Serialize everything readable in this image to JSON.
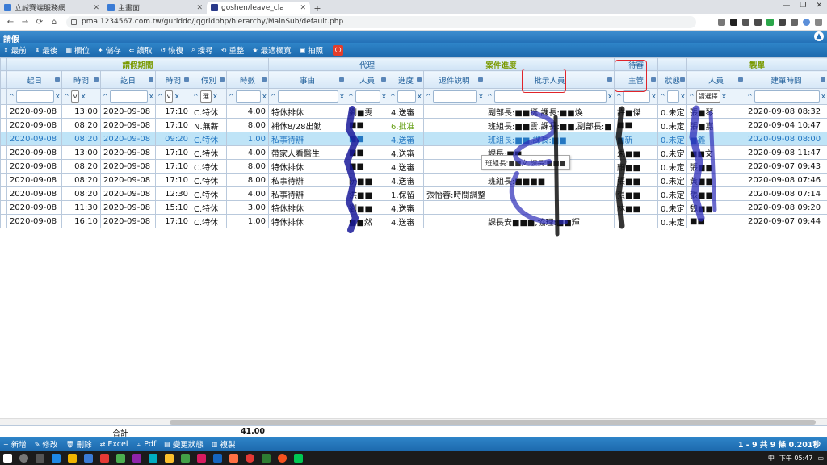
{
  "browser": {
    "tabs": [
      {
        "title": "立誠賽端服務網",
        "active": false
      },
      {
        "title": "主畫面",
        "active": false
      },
      {
        "title": "goshen/leave_cla",
        "active": true
      }
    ],
    "new_tab": "+",
    "url": "pma.1234567.com.tw/guriddo/jqgridphp/hierarchy/MainSub/default.php"
  },
  "app": {
    "title": "請假",
    "toolbar": [
      {
        "icon": "first-icon",
        "label": "最前"
      },
      {
        "icon": "last-icon",
        "label": "最後"
      },
      {
        "icon": "columns-icon",
        "label": "欄位"
      },
      {
        "icon": "save-icon",
        "label": "儲存"
      },
      {
        "icon": "load-icon",
        "label": "讀取"
      },
      {
        "icon": "restore-icon",
        "label": "恢復"
      },
      {
        "icon": "search-icon",
        "label": "搜尋"
      },
      {
        "icon": "reset-icon",
        "label": "重整"
      },
      {
        "icon": "fit-width-icon",
        "label": "最適欄寬"
      },
      {
        "icon": "camera-icon",
        "label": "拍照"
      }
    ]
  },
  "grid": {
    "groups": [
      {
        "label": "",
        "span": 1
      },
      {
        "label": "請假期間",
        "span": 6
      },
      {
        "label": "",
        "span": 1
      },
      {
        "label": "代理",
        "span": 1
      },
      {
        "label": "案件進度",
        "span": 3
      },
      {
        "label": "待審",
        "span": 1
      },
      {
        "label": "",
        "span": 1
      },
      {
        "label": "製單",
        "span": 2
      }
    ],
    "columns": [
      "起日",
      "時間",
      "訖日",
      "時間",
      "假別",
      "時數",
      "事由",
      "人員",
      "進度",
      "退件說明",
      "批示人員",
      "主管",
      "狀態",
      "人員",
      "建單時間"
    ],
    "filters": {
      "time_select": "v",
      "leave_select": "選",
      "maker_select": "請選擇"
    },
    "rows": [
      {
        "start": "2020-09-08",
        "stime": "13:00",
        "end": "2020-09-08",
        "etime": "17:10",
        "type": "C.特休",
        "hours": "4.00",
        "reason": "特休排休",
        "agent": "劉■雯",
        "progress": "4.送審",
        "reject": "",
        "approver": "副部長:■■挺,課長:■■煥",
        "supervisor": "許■傑",
        "status": "0.未定",
        "maker": "張■琴",
        "created": "2020-09-08 08:32"
      },
      {
        "start": "2020-09-08",
        "stime": "08:20",
        "end": "2020-09-08",
        "etime": "17:10",
        "type": "N.無薪",
        "hours": "8.00",
        "reason": "補休8/28出勤",
        "agent": "■■",
        "progress": "6.批准",
        "reject": "",
        "approver": "班組長:■■雲,課長:■■,副部長:■",
        "supervisor": "■■",
        "status": "0.未定",
        "maker": "張■嘉",
        "created": "2020-09-04 10:47"
      },
      {
        "start": "2020-09-08",
        "stime": "08:20",
        "end": "2020-09-08",
        "etime": "09:20",
        "type": "C.特休",
        "hours": "1.00",
        "reason": "私事待辦",
        "agent": "■■",
        "progress": "4.送審",
        "reject": "",
        "approver": "班組長:■■,課長:■■",
        "supervisor": "■新",
        "status": "0.未定",
        "maker": "■鑫",
        "created": "2020-09-08 08:00"
      },
      {
        "start": "2020-09-08",
        "stime": "13:00",
        "end": "2020-09-08",
        "etime": "17:10",
        "type": "C.特休",
        "hours": "4.00",
        "reason": "帶家人看醫生",
        "agent": "■■",
        "progress": "4.送審",
        "reject": "",
        "approver": "課長:■■",
        "supervisor": "朱■■",
        "status": "0.未定",
        "maker": "■■文",
        "created": "2020-09-08 11:47"
      },
      {
        "start": "2020-09-08",
        "stime": "08:20",
        "end": "2020-09-08",
        "etime": "17:10",
        "type": "C.特休",
        "hours": "8.00",
        "reason": "特休排休",
        "agent": "■■",
        "progress": "4.送審",
        "reject": "",
        "approver": "",
        "supervisor": "顏■■",
        "status": "0.未定",
        "maker": "張■■",
        "created": "2020-09-07 09:43"
      },
      {
        "start": "2020-09-08",
        "stime": "08:20",
        "end": "2020-09-08",
        "etime": "17:10",
        "type": "C.特休",
        "hours": "8.00",
        "reason": "私事待辦",
        "agent": "阮■■",
        "progress": "4.送審",
        "reject": "",
        "approver": "班組長:■■■■",
        "supervisor": "張■■",
        "status": "0.未定",
        "maker": "黃■■",
        "created": "2020-09-08 07:46"
      },
      {
        "start": "2020-09-08",
        "stime": "08:20",
        "end": "2020-09-08",
        "etime": "12:30",
        "type": "C.特休",
        "hours": "4.00",
        "reason": "私事待辦",
        "agent": "洪■■",
        "progress": "1.保留",
        "reject": "張怡蓉:時間調整",
        "approver": "",
        "supervisor": "張■■",
        "status": "0.未定",
        "maker": "張■■",
        "created": "2020-09-08 07:14"
      },
      {
        "start": "2020-09-08",
        "stime": "11:30",
        "end": "2020-09-08",
        "etime": "15:10",
        "type": "C.特休",
        "hours": "3.00",
        "reason": "特休排休",
        "agent": "劉■■",
        "progress": "4.送審",
        "reject": "",
        "approver": "",
        "supervisor": "林■■",
        "status": "0.未定",
        "maker": "魏■■",
        "created": "2020-09-08 09:20"
      },
      {
        "start": "2020-09-08",
        "stime": "16:10",
        "end": "2020-09-08",
        "etime": "17:10",
        "type": "C.特休",
        "hours": "1.00",
        "reason": "特休排休",
        "agent": "■■然",
        "progress": "4.送審",
        "reject": "",
        "approver": "課長安■■■,協理:■■輝",
        "supervisor": "",
        "status": "0.未定",
        "maker": "■■",
        "created": "2020-09-07 09:44"
      }
    ],
    "tooltip": "班組長:■■文,課長:■■■",
    "footer": {
      "label": "合計",
      "total": "41.00"
    }
  },
  "bottom_bar": {
    "actions": [
      {
        "icon": "add-icon",
        "label": "新增"
      },
      {
        "icon": "edit-icon",
        "label": "修改"
      },
      {
        "icon": "delete-icon",
        "label": "刪除"
      },
      {
        "icon": "excel-icon",
        "label": "Excel"
      },
      {
        "icon": "pdf-icon",
        "label": "Pdf"
      },
      {
        "icon": "status-icon",
        "label": "變更狀態"
      },
      {
        "icon": "copy-icon",
        "label": "複製"
      }
    ],
    "pager": "1 - 9 共 9 條 0.201秒"
  },
  "taskbar": {
    "tray_text": "中",
    "clock": "下午 05:47"
  },
  "colors": {
    "header_blue": "#2371b8",
    "selected_row": "#bfe4f7",
    "approved_green": "#6aa21c",
    "highlight_red": "#e0242a"
  }
}
